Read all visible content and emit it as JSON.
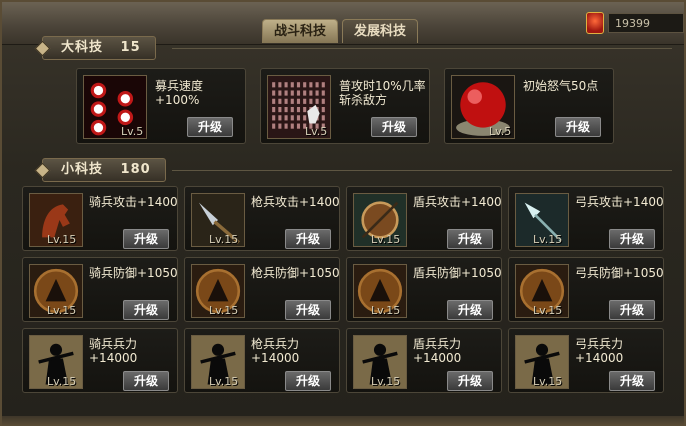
{
  "tabs": [
    {
      "label": "战斗科技",
      "active": true
    },
    {
      "label": "发展科技",
      "active": false
    }
  ],
  "gold": "19399",
  "big_section": {
    "label": "大科技",
    "count": "15"
  },
  "small_section": {
    "label": "小科技",
    "count": "180"
  },
  "upgrade_label": "升级",
  "big_items": [
    {
      "desc": "募兵速度",
      "desc2": "+100%",
      "level": "Lv.5",
      "icon": "dots-icon"
    },
    {
      "desc": "普攻时10%几率",
      "desc2": "斩杀敌方",
      "level": "Lv.5",
      "icon": "army-icon"
    },
    {
      "desc": "初始怒气50点",
      "desc2": "",
      "level": "Lv.5",
      "icon": "red-orb-icon"
    }
  ],
  "small_items": [
    {
      "desc": "骑兵攻击+1400",
      "desc2": "",
      "level": "Lv.15",
      "icon": "horse-icon"
    },
    {
      "desc": "枪兵攻击+1400",
      "desc2": "",
      "level": "Lv.15",
      "icon": "spear-icon"
    },
    {
      "desc": "盾兵攻击+1400",
      "desc2": "",
      "level": "Lv.15",
      "icon": "shield-icon"
    },
    {
      "desc": "弓兵攻击+1400",
      "desc2": "",
      "level": "Lv.15",
      "icon": "arrow-icon"
    },
    {
      "desc": "骑兵防御+1050",
      "desc2": "",
      "level": "Lv.15",
      "icon": "cavalry-defense-icon"
    },
    {
      "desc": "枪兵防御+1050",
      "desc2": "",
      "level": "Lv.15",
      "icon": "spear-defense-icon"
    },
    {
      "desc": "盾兵防御+1050",
      "desc2": "",
      "level": "Lv.15",
      "icon": "shield-defense-icon"
    },
    {
      "desc": "弓兵防御+1050",
      "desc2": "",
      "level": "Lv.15",
      "icon": "archer-defense-icon"
    },
    {
      "desc": "骑兵兵力",
      "desc2": "+14000",
      "level": "Lv.15",
      "icon": "cavalry-soldier-icon"
    },
    {
      "desc": "枪兵兵力",
      "desc2": "+14000",
      "level": "Lv.15",
      "icon": "spear-soldier-icon"
    },
    {
      "desc": "盾兵兵力",
      "desc2": "+14000",
      "level": "Lv.15",
      "icon": "shield-soldier-icon"
    },
    {
      "desc": "弓兵兵力",
      "desc2": "+14000",
      "level": "Lv.15",
      "icon": "archer-soldier-icon"
    }
  ]
}
